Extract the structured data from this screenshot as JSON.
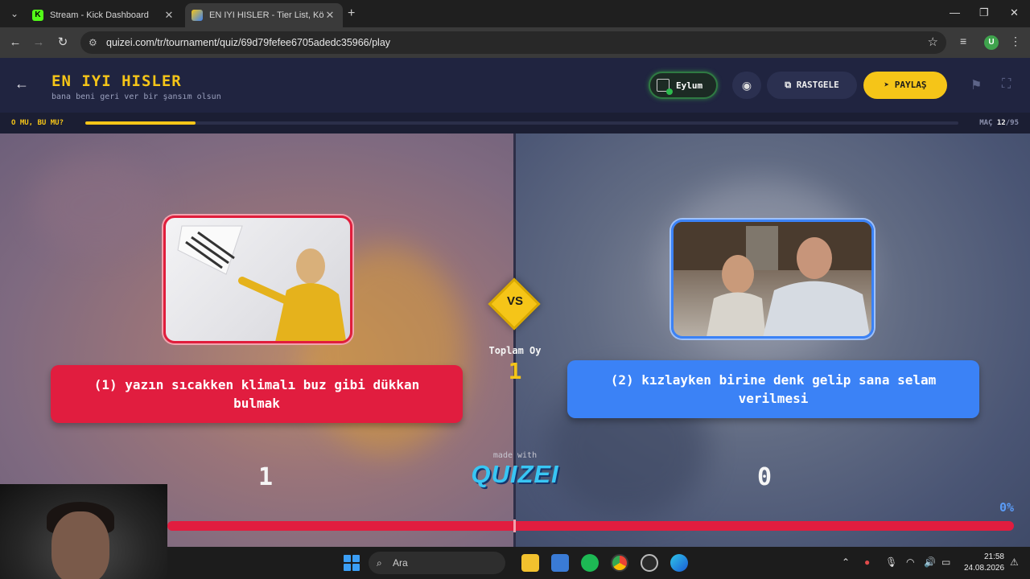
{
  "browser": {
    "tabs": [
      {
        "title": "Stream - Kick Dashboard",
        "favicon": "K",
        "active": false
      },
      {
        "title": "EN IYI HISLER - Tier List, Kör Sır",
        "favicon": "quizei-favicon",
        "active": true
      }
    ],
    "url": "quizei.com/tr/tournament/quiz/69d79fefee6705adedc35966/play",
    "profile_initial": "U"
  },
  "header": {
    "title": "EN IYI HISLER",
    "subtitle": "bana beni geri ver bir şansım olsun",
    "user_name": "Eylum",
    "random_label": "RASTGELE",
    "share_label": "PAYLAŞ"
  },
  "progress": {
    "round_label": "O MU, BU MU?",
    "match_prefix": "MAÇ",
    "match_current": "12",
    "match_total": "/95",
    "fraction": 0.1263
  },
  "arena": {
    "vs_label": "VS",
    "total_votes_label": "Toplam Oy",
    "total_votes": "1",
    "left_option": "(1) yazın sıcakken klimalı buz gibi dükkan bulmak",
    "right_option": "(2) kızlayken birine denk gelip sana selam verilmesi",
    "left_score": "1",
    "right_score": "0",
    "made_with": "made with",
    "brand": "QUIZEI",
    "right_percent": "0%"
  },
  "taskbar": {
    "search_label": "Ara",
    "time": "21:58",
    "date": "24.08.2026"
  },
  "colors": {
    "accent": "#f5c518",
    "left": "#e11d3f",
    "right": "#3b82f6"
  }
}
